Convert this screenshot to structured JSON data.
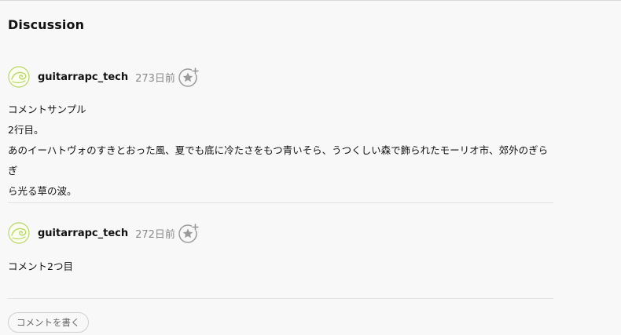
{
  "discussion": {
    "heading": "Discussion",
    "comments": [
      {
        "author": "guitarrapc_tech",
        "time": "273日前",
        "lines": [
          "コメントサンプル",
          "2行目。",
          "あのイーハトヴォのすきとおった風、夏でも底に冷たさをもつ青いそら、うつくしい森で飾られたモーリオ市、郊外のぎらぎ",
          "ら光る草の波。"
        ]
      },
      {
        "author": "guitarrapc_tech",
        "time": "272日前",
        "lines": [
          "コメント2つ目"
        ]
      }
    ],
    "write_button_label": "コメントを書く"
  },
  "colors": {
    "avatar_stroke": "#b8d66a",
    "like_icon": "#9a9a9a"
  }
}
